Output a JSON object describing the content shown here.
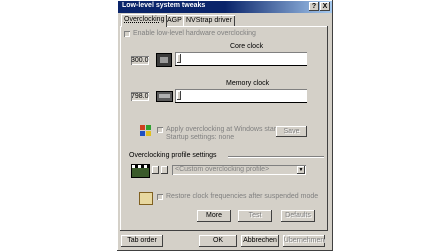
{
  "window": {
    "title": "Low-level system tweaks",
    "help_label": "?",
    "close_label": "X"
  },
  "tabs": [
    {
      "label": "Overclocking",
      "active": true
    },
    {
      "label": "AGP",
      "active": false
    },
    {
      "label": "NVStrap driver",
      "active": false
    }
  ],
  "overclocking": {
    "enable_label": "Enable low-level hardware overclocking",
    "enable_checked": false,
    "core": {
      "label": "Core clock",
      "value": "300.0"
    },
    "memory": {
      "label": "Memory clock",
      "value": "798.0"
    },
    "startup": {
      "apply_label": "Apply overclocking at Windows startup",
      "apply_checked": false,
      "settings_label": "Startup settings: none",
      "save_label": "Save"
    },
    "profile": {
      "section_label": "Overclocking profile settings",
      "selected": "<Custom overclocking profile>"
    },
    "restore_label": "Restore clock frequencies after suspended mode",
    "restore_checked": false,
    "more_label": "More",
    "test_label": "Test",
    "defaults_label": "Defaults"
  },
  "footer": {
    "tab_order_label": "Tab order",
    "ok_label": "OK",
    "cancel_label": "Abbrechen",
    "apply_label": "Übernehmen"
  }
}
